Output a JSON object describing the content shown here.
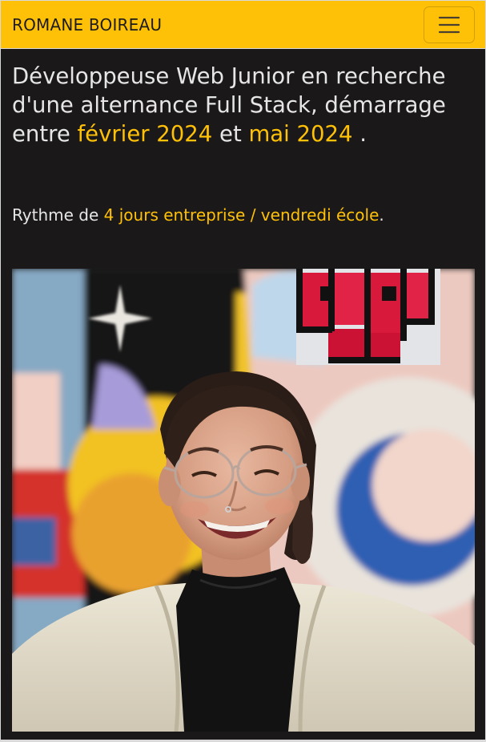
{
  "navbar": {
    "brand": "ROMANE BOIREAU",
    "toggler_icon": "hamburger-menu-icon"
  },
  "intro": {
    "headline_part1": "Développeuse Web Junior en recherche d'une alternance Full Stack, démarrage entre ",
    "headline_date1": "février 2024",
    "headline_and": " et ",
    "headline_date2": "mai 2024",
    "headline_end": " .",
    "rythme_prefix": "Rythme de ",
    "rythme_company": "4 jours entreprise",
    "rythme_separator": " / ",
    "rythme_school": "vendredi école",
    "rythme_end": "."
  },
  "colors": {
    "navbar_background": "#ffc107",
    "page_background": "#1a1818",
    "text": "#e6e6e6",
    "accent": "#ffc107"
  }
}
